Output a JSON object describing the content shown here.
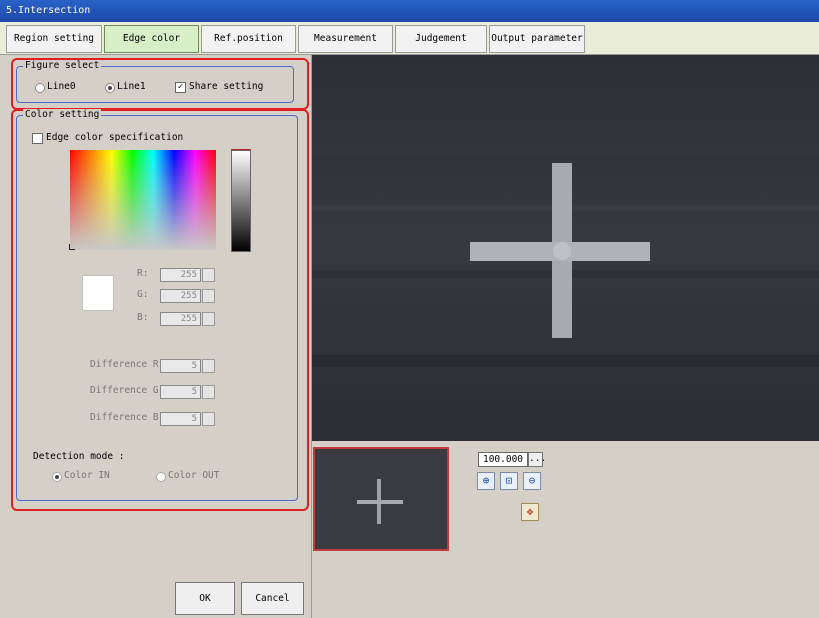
{
  "window": {
    "title": "5.Intersection"
  },
  "tabs": [
    {
      "label": "Region setting",
      "active": false
    },
    {
      "label": "Edge color",
      "active": true
    },
    {
      "label": "Ref.position",
      "active": false
    },
    {
      "label": "Measurement",
      "active": false
    },
    {
      "label": "Judgement",
      "active": false
    },
    {
      "label": "Output parameter",
      "active": false
    }
  ],
  "figure_select": {
    "legend": "Figure select",
    "line0_label": "Line0",
    "line1_label": "Line1",
    "share_setting_label": "Share setting",
    "selected": "Line1",
    "share_setting_checked": true
  },
  "color_setting": {
    "legend": "Color setting",
    "edge_color_spec_label": "Edge color specification",
    "edge_color_spec_checked": false,
    "swatch_color": "#ffffff",
    "r_label": "R:",
    "r_value": "255",
    "g_label": "G:",
    "g_value": "255",
    "b_label": "B:",
    "b_value": "255",
    "diff_r_label": "Difference R",
    "diff_r_value": "5",
    "diff_g_label": "Difference G",
    "diff_g_value": "5",
    "diff_b_label": "Difference B",
    "diff_b_value": "5",
    "detection_mode_label": "Detection mode :",
    "color_in_label": "Color IN",
    "color_out_label": "Color OUT",
    "detection_selected": "Color IN"
  },
  "zoom": {
    "value": "100.000",
    "more_label": "..."
  },
  "buttons": {
    "ok": "OK",
    "cancel": "Cancel"
  },
  "colors": {
    "highlight_red": "#e02020",
    "group_blue": "#4a6cc8",
    "active_tab": "#d8eec8"
  }
}
